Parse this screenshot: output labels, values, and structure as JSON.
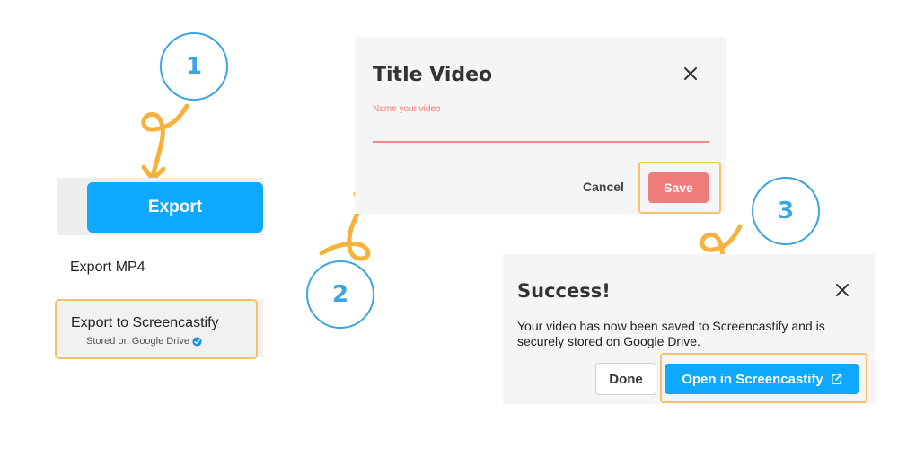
{
  "steps": [
    "1",
    "2",
    "3"
  ],
  "export_panel": {
    "export_button": "Export",
    "export_mp4": "Export MP4",
    "export_screencastify": "Export to Screencastify",
    "stored_note": "Stored on Google Drive"
  },
  "title_dialog": {
    "title": "Title Video",
    "field_placeholder": "Name your video",
    "field_value": "",
    "cancel_label": "Cancel",
    "save_label": "Save"
  },
  "success_dialog": {
    "title": "Success!",
    "message": "Your video has now been saved to Screencastify and is securely stored on Google Drive.",
    "done_label": "Done",
    "open_label": "Open in Screencastify"
  },
  "icons": {
    "close": "close-icon",
    "verified": "verified-check-icon",
    "external_link": "external-link-icon"
  },
  "colors": {
    "accent_blue": "#0ea8ff",
    "step_circle": "#3aa3e3",
    "annotation_orange": "#f5b23c",
    "highlight_outline": "#f5c26b",
    "save_red": "#f07b7b",
    "field_underline": "#f08a8a"
  }
}
